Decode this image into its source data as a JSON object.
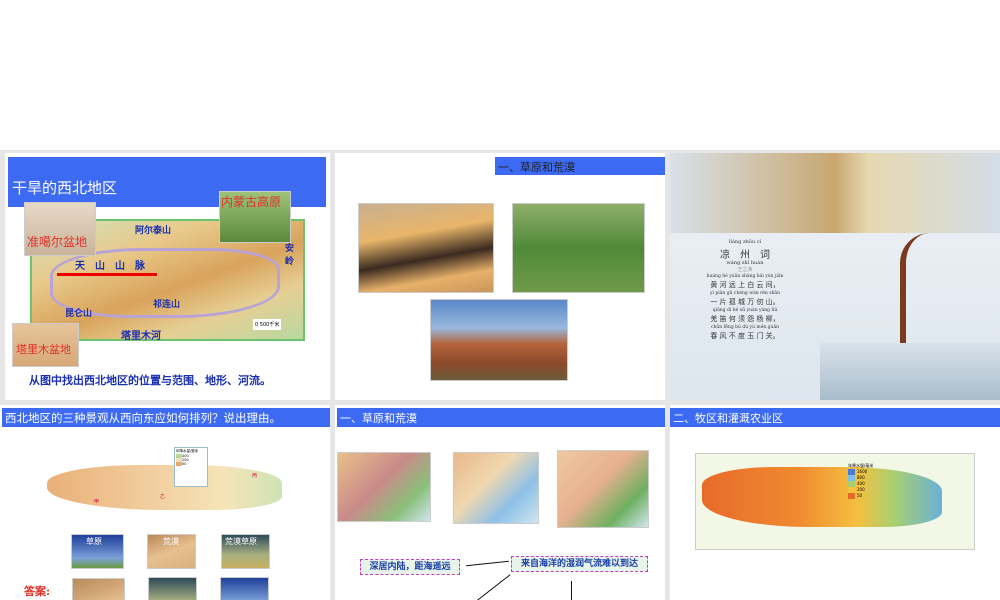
{
  "slides": [
    {
      "title": "干旱的西北地区",
      "labels": {
        "junggar": "准噶尔盆地",
        "inner_mongolia": "内蒙古高原",
        "altai": "阿尔泰山",
        "tianshan": "天　山　山　脉",
        "kunlun": "昆仑山",
        "qilian": "祁连山",
        "tarim_river": "塔里木河",
        "tarim_basin": "塔里木盆地",
        "hinggan": "安岭",
        "scale": "0  500千米"
      },
      "caption": "从图中找出西北地区的位置与范围、地形、河流。"
    },
    {
      "title": "一、草原和荒漠"
    },
    {
      "poem": {
        "title_pinyin": "liáng zhōu cí",
        "title": "凉　州　词",
        "author_pinyin": "wáng zhī huàn",
        "author": "王之涣",
        "lines": [
          {
            "py": "huáng hé yuǎn shàng bái yún jiān",
            "text": "黄 河 远 上 白 云 间，"
          },
          {
            "py": "yí piàn gū chéng wàn rèn shān",
            "text": "一 片 孤 城 万 仞 山。"
          },
          {
            "py": "qiāng dí hé xū yuàn yáng liǔ",
            "text": "羌 笛 何 须 怨 杨 柳，"
          },
          {
            "py": "chūn fēng bú dù yù mén guān",
            "text": "春 风 不 度 玉 门 关。"
          }
        ]
      }
    },
    {
      "title": "西北地区的三种景观从西向东应如何排列？说出理由。",
      "map_labels": [
        "甲",
        "乙",
        "丙"
      ],
      "legend_title": "年降水量/毫米",
      "legend_values": [
        "400",
        "200",
        "50"
      ],
      "photos": [
        "草原",
        "荒漠",
        "荒漠草原"
      ],
      "answer": "答案:"
    },
    {
      "title": "一、草原和荒漠",
      "box1": "深居内陆，距海遥远",
      "box2": "来自海洋的湿润气流难以到达"
    },
    {
      "title": "二、牧区和灌溉农业区",
      "legend_title": "年降水量/毫米",
      "legend_values": [
        "1600",
        "800",
        "400",
        "200",
        "50"
      ]
    }
  ],
  "colors": {
    "title_bar": "#3d6af2",
    "label_blue": "#1a2fb0",
    "label_red": "#e0302a"
  }
}
